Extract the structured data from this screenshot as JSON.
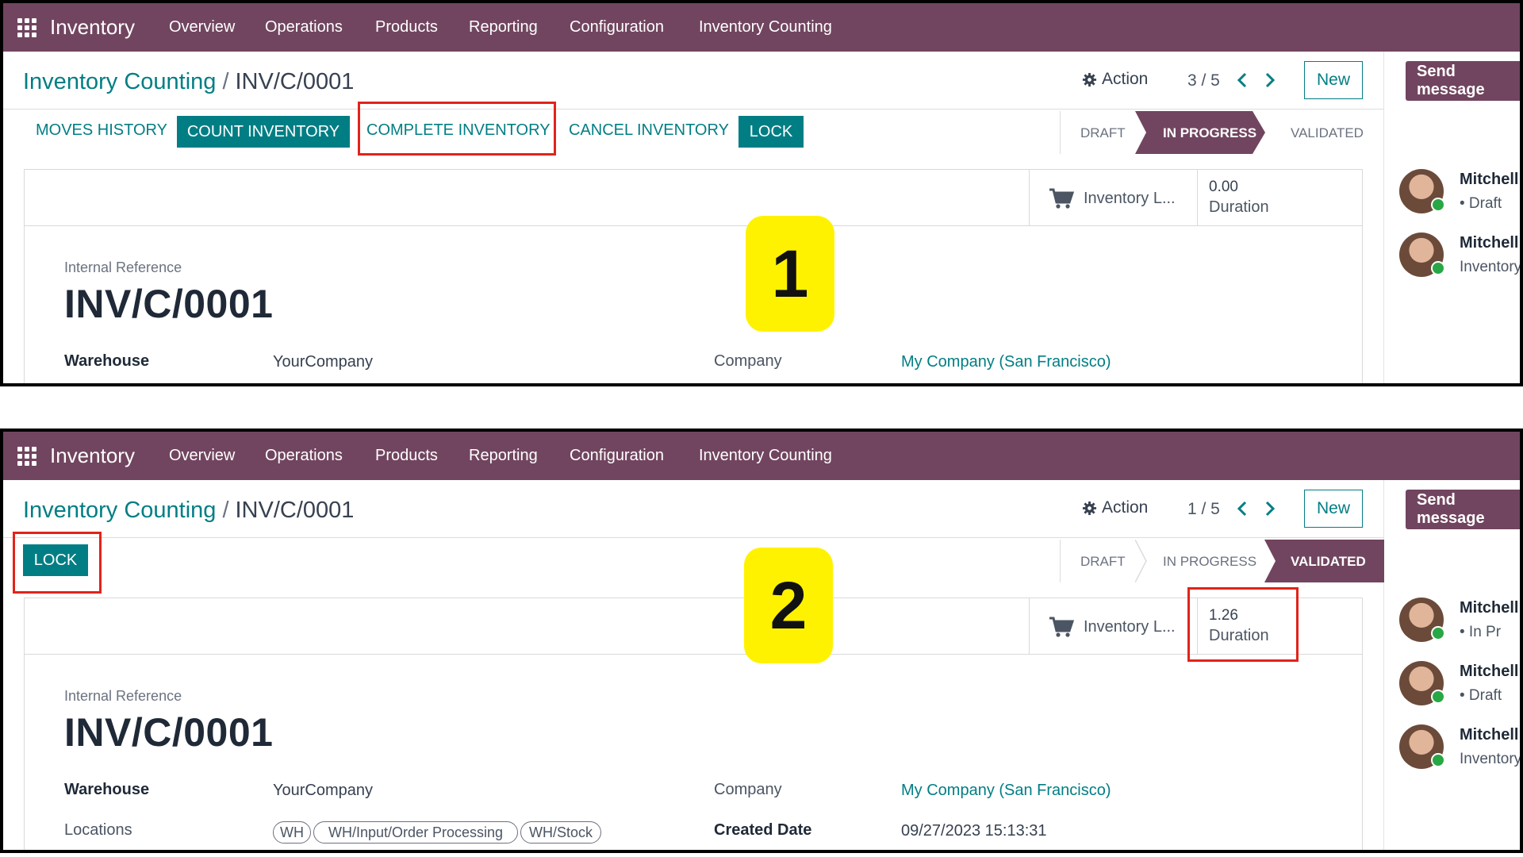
{
  "nav": {
    "app": "Inventory",
    "items": [
      "Overview",
      "Operations",
      "Products",
      "Reporting",
      "Configuration",
      "Inventory Counting"
    ]
  },
  "colors": {
    "brand": "#71455f",
    "accent": "#017e84",
    "highlight": "#e2231a",
    "badge": "#fff200"
  },
  "icons": [
    "apps-grid-icon",
    "gear-icon",
    "chevron-left-icon",
    "chevron-right-icon",
    "cart-icon",
    "avatar"
  ],
  "panel1": {
    "badge": "1",
    "breadcrumb": {
      "parent": "Inventory Counting",
      "sep": "/",
      "current": "INV/C/0001"
    },
    "action": "Action",
    "pager": "3 / 5",
    "new": "New",
    "send_message": "Send message",
    "buttons": {
      "moves_history": "MOVES HISTORY",
      "count_inventory": "COUNT INVENTORY",
      "complete_inventory": "COMPLETE INVENTORY",
      "cancel_inventory": "CANCEL INVENTORY",
      "lock": "LOCK"
    },
    "stages": [
      "DRAFT",
      "IN PROGRESS",
      "VALIDATED"
    ],
    "active_stage": "IN PROGRESS",
    "smart": {
      "inventory": "Inventory L...",
      "duration_value": "0.00",
      "duration_label": "Duration"
    },
    "form": {
      "internal_reference_label": "Internal Reference",
      "internal_reference": "INV/C/0001",
      "warehouse_label": "Warehouse",
      "warehouse": "YourCompany",
      "company_label": "Company",
      "company": "My Company (San Francisco)"
    },
    "chatter": [
      {
        "name": "Mitchell",
        "line": "• Draft"
      },
      {
        "name": "Mitchell",
        "line": "Inventory"
      }
    ]
  },
  "panel2": {
    "badge": "2",
    "breadcrumb": {
      "parent": "Inventory Counting",
      "sep": "/",
      "current": "INV/C/0001"
    },
    "action": "Action",
    "pager": "1 / 5",
    "new": "New",
    "send_message": "Send message",
    "buttons": {
      "lock": "LOCK"
    },
    "stages": [
      "DRAFT",
      "IN PROGRESS",
      "VALIDATED"
    ],
    "active_stage": "VALIDATED",
    "smart": {
      "inventory": "Inventory L...",
      "duration_value": "1.26",
      "duration_label": "Duration"
    },
    "form": {
      "internal_reference_label": "Internal Reference",
      "internal_reference": "INV/C/0001",
      "warehouse_label": "Warehouse",
      "warehouse": "YourCompany",
      "company_label": "Company",
      "company": "My Company (San Francisco)",
      "locations_label": "Locations",
      "locations": [
        "WH",
        "WH/Input/Order Processing",
        "WH/Stock"
      ],
      "created_date_label": "Created Date",
      "created_date": "09/27/2023 15:13:31"
    },
    "chatter": [
      {
        "name": "Mitchell",
        "line": "• In Pr"
      },
      {
        "name": "Mitchell",
        "line": "• Draft"
      },
      {
        "name": "Mitchell",
        "line": "Inventory"
      }
    ]
  }
}
